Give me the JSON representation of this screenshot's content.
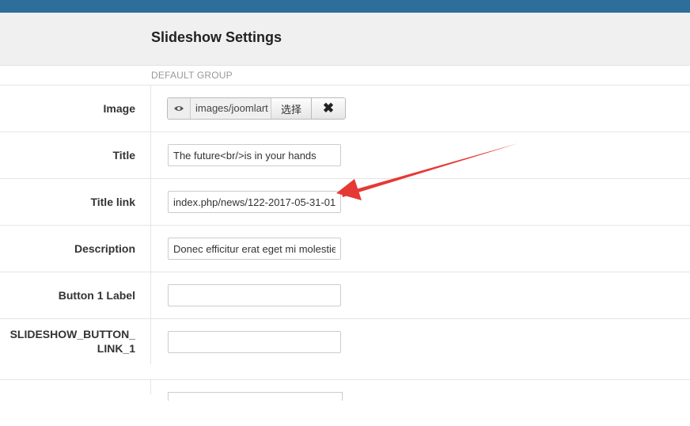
{
  "page": {
    "title": "Slideshow Settings",
    "group": "DEFAULT GROUP"
  },
  "fields": {
    "image": {
      "label": "Image",
      "value": "images/joomlart",
      "select_label": "选择",
      "clear_symbol": "✖"
    },
    "title": {
      "label": "Title",
      "value": "The future<br/>is in your hands"
    },
    "title_link": {
      "label": "Title link",
      "value": "index.php/news/122-2017-05-31-01-"
    },
    "description": {
      "label": "Description",
      "value": "Donec efficitur erat eget mi molestie"
    },
    "button1_label": {
      "label": "Button 1 Label",
      "value": ""
    },
    "button1_link": {
      "label": "SLIDESHOW_BUTTON_ LINK_1",
      "value": ""
    }
  },
  "annotation": {
    "arrow_color": "#e53935"
  },
  "colors": {
    "topbar": "#2e6e9a",
    "header_bg": "#f0f0f0"
  }
}
